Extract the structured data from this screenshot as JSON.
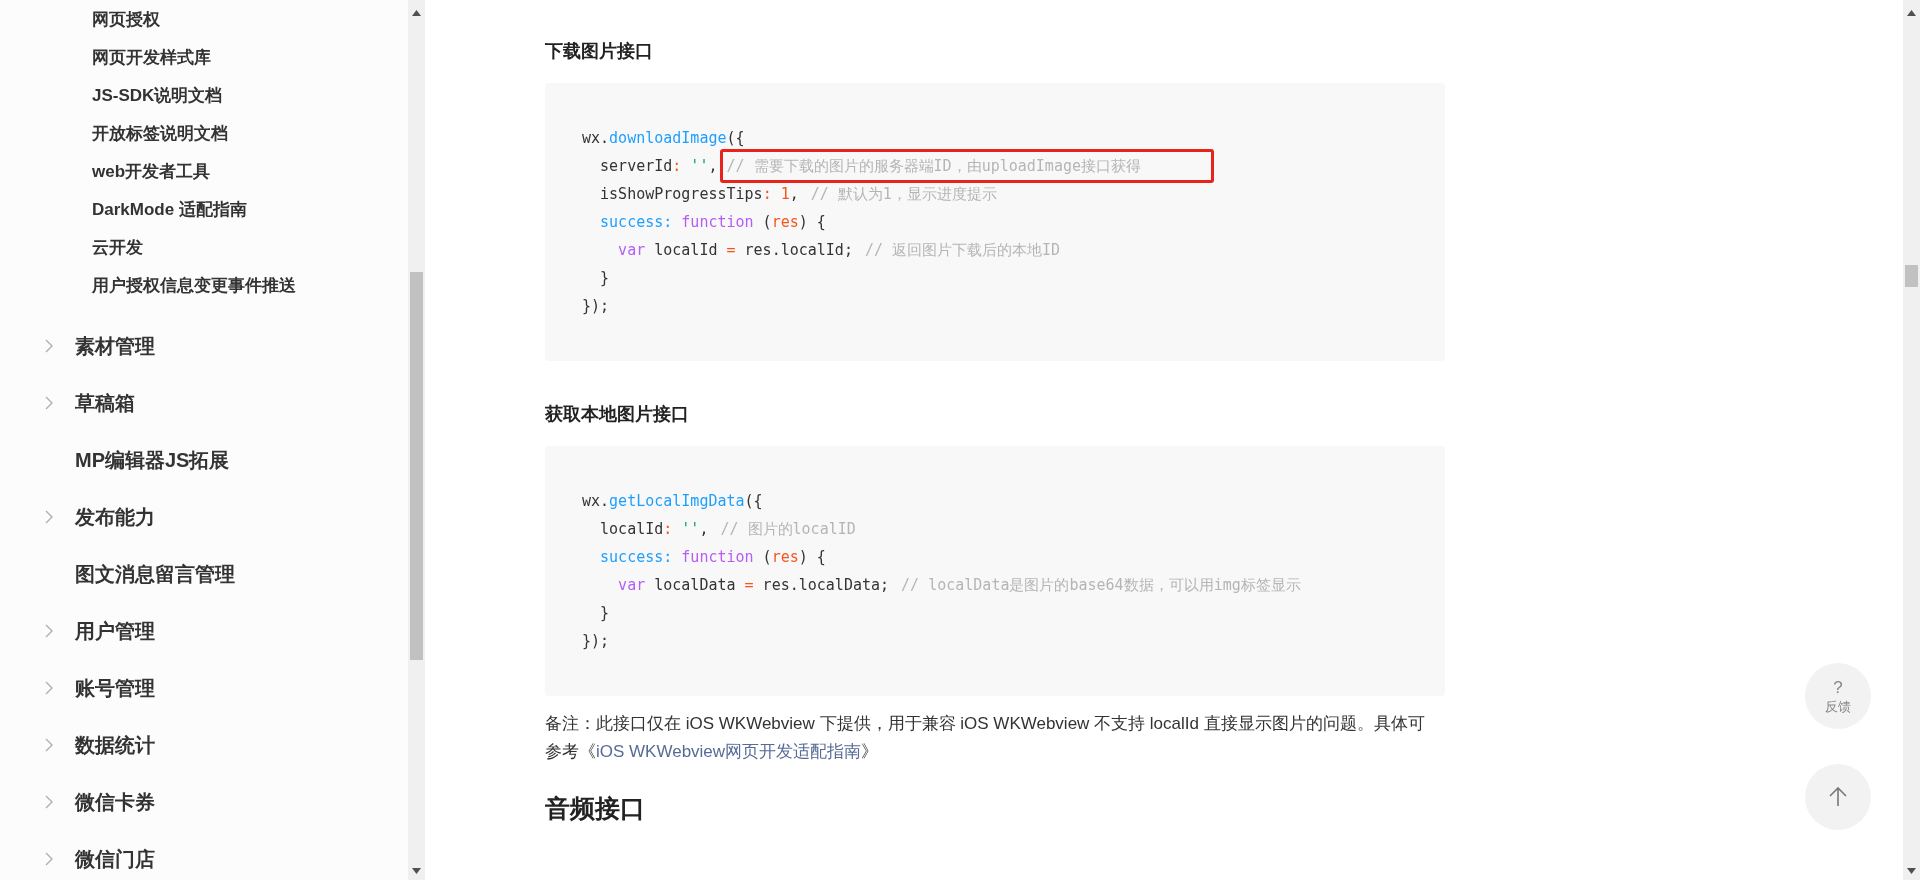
{
  "sidebar": {
    "sub_items": [
      "网页授权",
      "网页开发样式库",
      "JS-SDK说明文档",
      "开放标签说明文档",
      "web开发者工具",
      "DarkMode 适配指南",
      "云开发",
      "用户授权信息变更事件推送"
    ],
    "items": [
      {
        "label": "素材管理",
        "expandable": true
      },
      {
        "label": "草稿箱",
        "expandable": true
      },
      {
        "label": "MP编辑器JS拓展",
        "expandable": false
      },
      {
        "label": "发布能力",
        "expandable": true
      },
      {
        "label": "图文消息留言管理",
        "expandable": false
      },
      {
        "label": "用户管理",
        "expandable": true
      },
      {
        "label": "账号管理",
        "expandable": true
      },
      {
        "label": "数据统计",
        "expandable": true
      },
      {
        "label": "微信卡券",
        "expandable": true
      },
      {
        "label": "微信门店",
        "expandable": true
      }
    ]
  },
  "sections": [
    {
      "heading": "下载图片接口",
      "large": false,
      "code": [
        [
          {
            "t": "wx.",
            "kind": "plain"
          },
          {
            "t": "downloadImage",
            "kind": "func"
          },
          {
            "t": "({",
            "kind": "plain"
          }
        ],
        [
          {
            "t": "  serverId",
            "kind": "plain"
          },
          {
            "t": ":",
            "kind": "op"
          },
          {
            "t": " ''",
            "kind": "string"
          },
          {
            "t": ", ",
            "kind": "plain"
          },
          {
            "t": "// 需要下载的图片的服务器端ID，由uploadImage接口获得",
            "kind": "comment",
            "highlighted": true
          }
        ],
        [
          {
            "t": "  isShowProgressTips",
            "kind": "plain"
          },
          {
            "t": ":",
            "kind": "op"
          },
          {
            "t": " 1",
            "kind": "number"
          },
          {
            "t": ", ",
            "kind": "plain"
          },
          {
            "t": "// 默认为1，显示进度提示",
            "kind": "comment",
            "highlighted": false
          }
        ],
        [
          {
            "t": "  success:",
            "kind": "func"
          },
          {
            "t": " function",
            "kind": "keyword"
          },
          {
            "t": " (",
            "kind": "plain"
          },
          {
            "t": "res",
            "kind": "number"
          },
          {
            "t": ") {",
            "kind": "plain"
          }
        ],
        [
          {
            "t": "    var",
            "kind": "keyword"
          },
          {
            "t": " localId ",
            "kind": "plain"
          },
          {
            "t": "=",
            "kind": "op"
          },
          {
            "t": " res.localId; ",
            "kind": "plain"
          },
          {
            "t": "// 返回图片下载后的本地ID",
            "kind": "comment",
            "highlighted": false
          }
        ],
        [
          {
            "t": "  }",
            "kind": "plain"
          }
        ],
        [
          {
            "t": "});",
            "kind": "plain"
          }
        ]
      ]
    },
    {
      "heading": "获取本地图片接口",
      "large": false,
      "code": [
        [
          {
            "t": "wx.",
            "kind": "plain"
          },
          {
            "t": "getLocalImgData",
            "kind": "func"
          },
          {
            "t": "({",
            "kind": "plain"
          }
        ],
        [
          {
            "t": "  localId",
            "kind": "plain"
          },
          {
            "t": ":",
            "kind": "op"
          },
          {
            "t": " ''",
            "kind": "string"
          },
          {
            "t": ", ",
            "kind": "plain"
          },
          {
            "t": "// 图片的localID",
            "kind": "comment",
            "highlighted": false
          }
        ],
        [
          {
            "t": "  success:",
            "kind": "func"
          },
          {
            "t": " function",
            "kind": "keyword"
          },
          {
            "t": " (",
            "kind": "plain"
          },
          {
            "t": "res",
            "kind": "number"
          },
          {
            "t": ") {",
            "kind": "plain"
          }
        ],
        [
          {
            "t": "    var",
            "kind": "keyword"
          },
          {
            "t": " localData ",
            "kind": "plain"
          },
          {
            "t": "=",
            "kind": "op"
          },
          {
            "t": " res.localData; ",
            "kind": "plain"
          },
          {
            "t": "// localData是图片的base64数据，可以用img标签显示",
            "kind": "comment",
            "highlighted": false
          }
        ],
        [
          {
            "t": "  }",
            "kind": "plain"
          }
        ],
        [
          {
            "t": "});",
            "kind": "plain"
          }
        ]
      ],
      "note": {
        "text": "备注：此接口仅在 iOS WKWebview 下提供，用于兼容 iOS WKWebview 不支持 localId 直接显示图片的问题。具体可参考《",
        "link": "iOS WKWebview网页开发适配指南",
        "after": "》"
      }
    },
    {
      "heading": "音频接口",
      "large": true
    }
  ],
  "float_buttons": {
    "feedback_symbol": "?",
    "feedback_label": "反馈"
  }
}
